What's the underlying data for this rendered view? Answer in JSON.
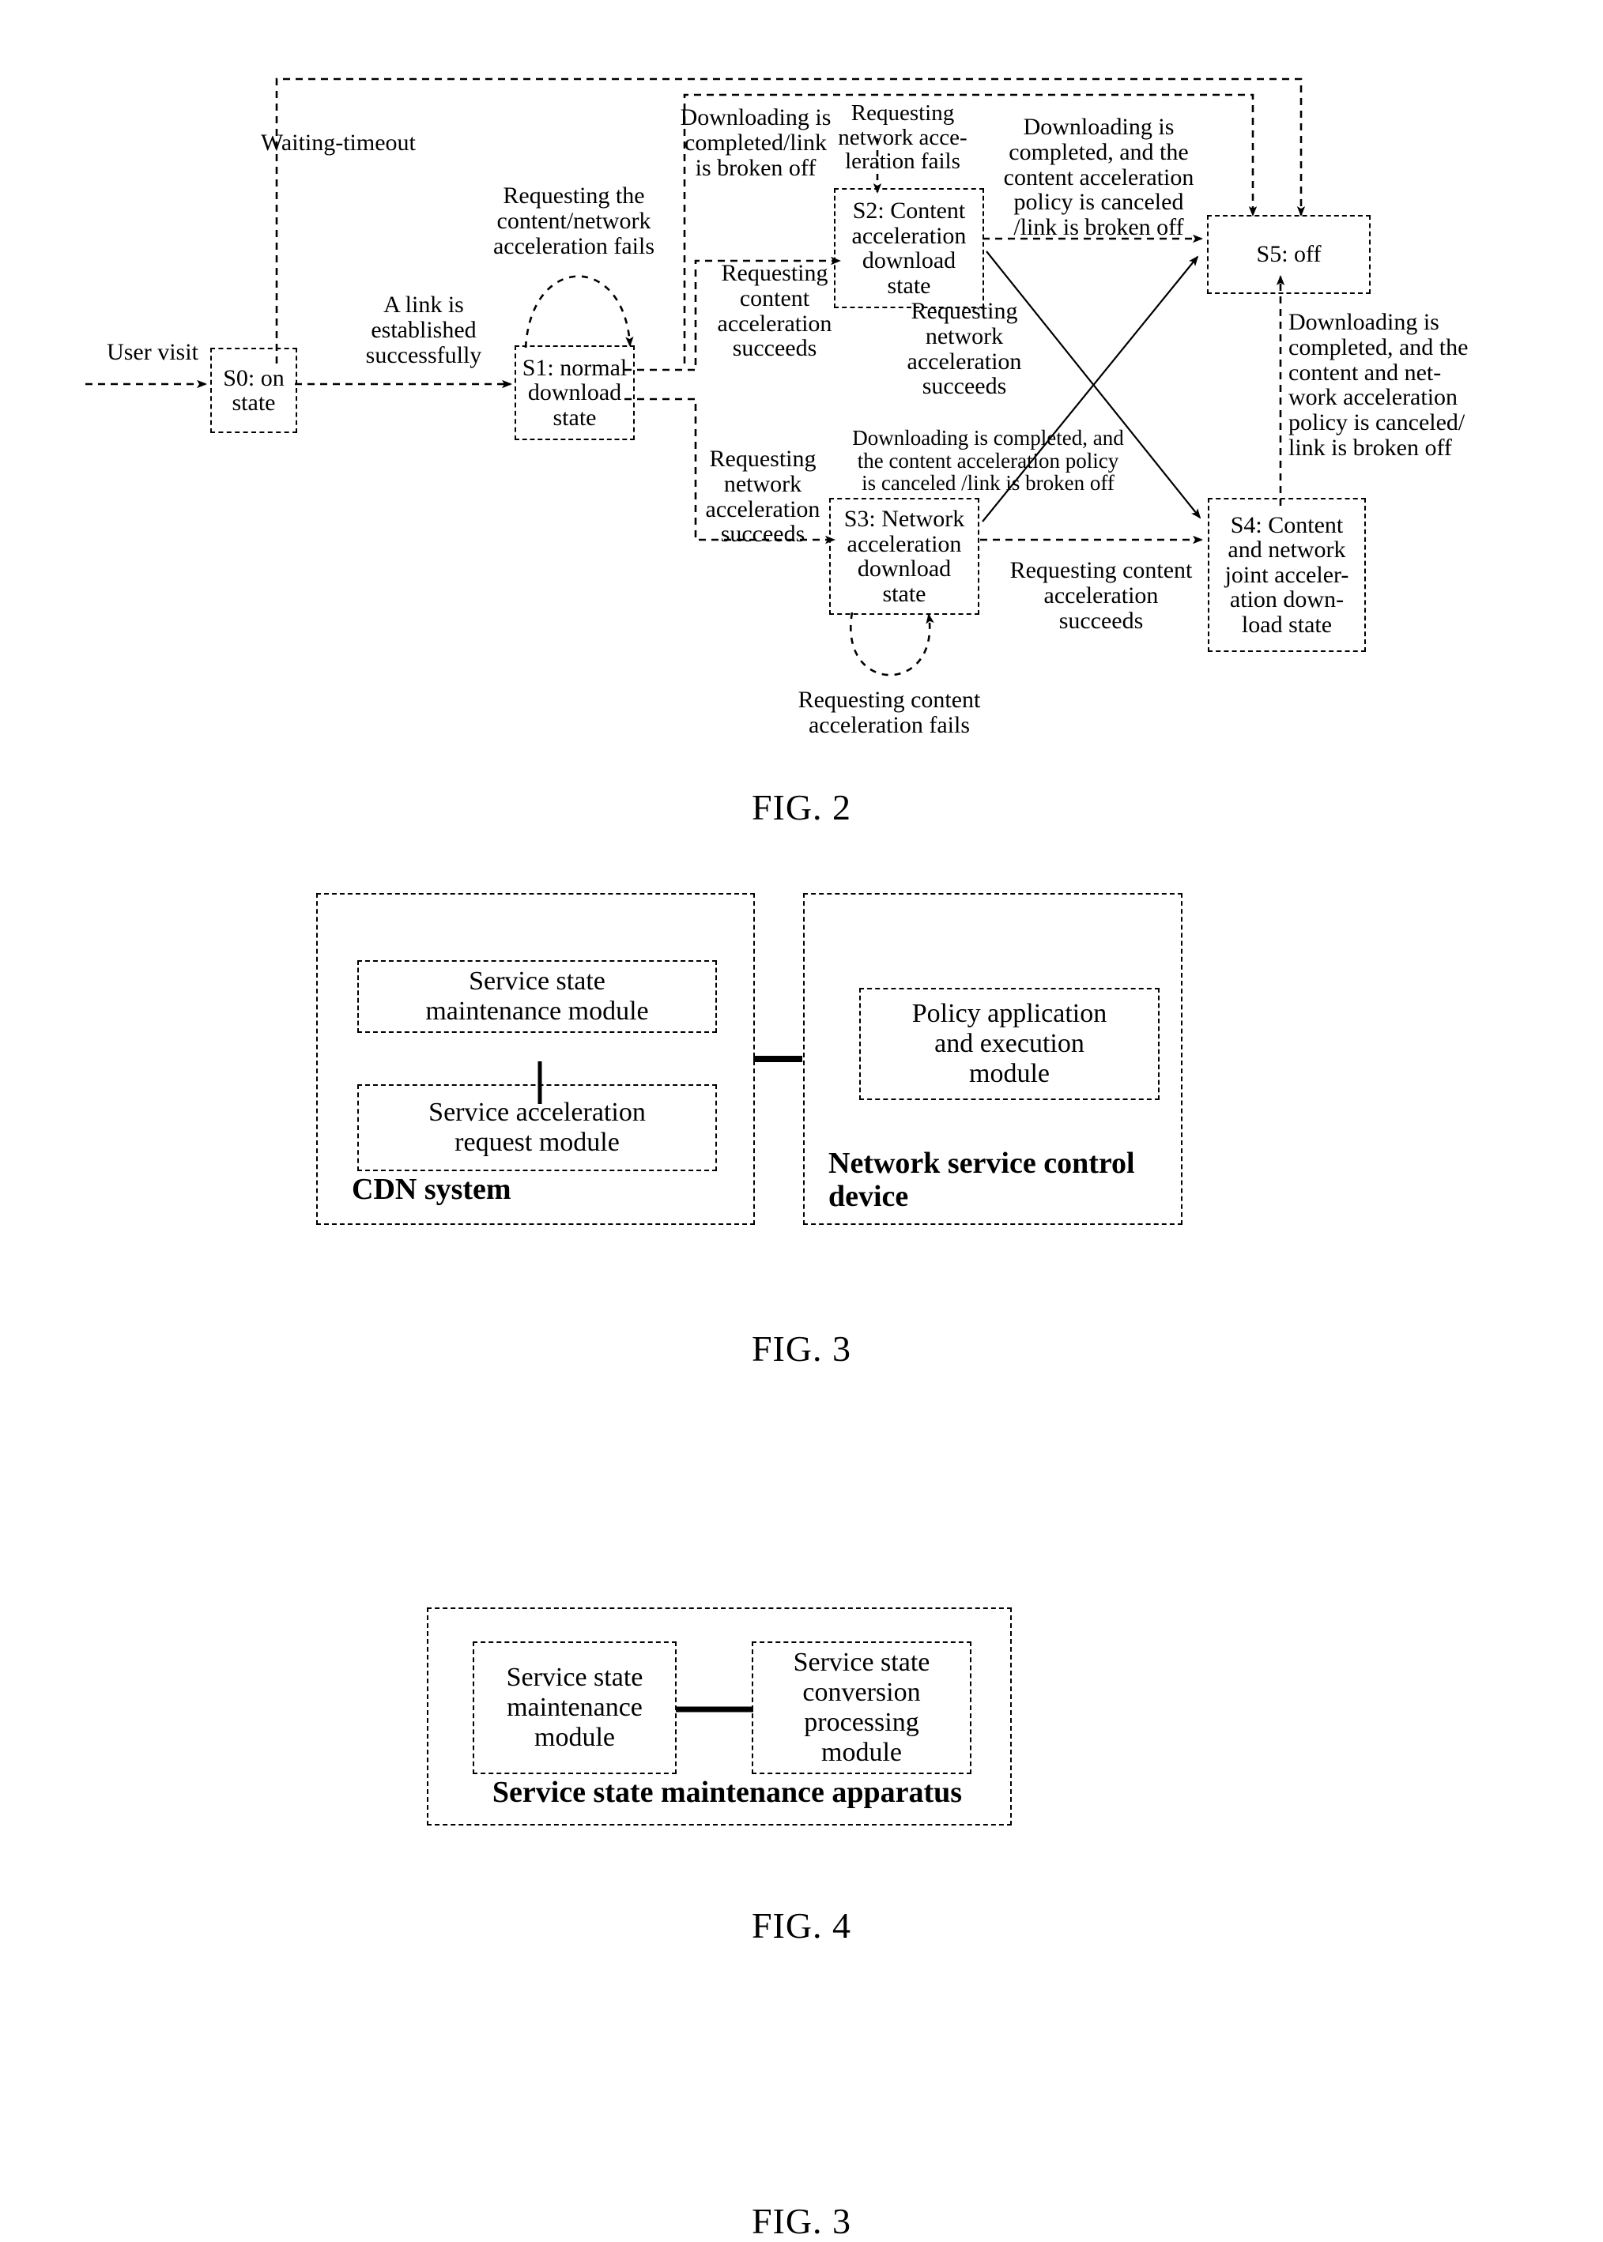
{
  "figures": [
    {
      "caption": "FIG. 2",
      "states": [
        {
          "id": "S0",
          "label": "S0: on\nstate"
        },
        {
          "id": "S1",
          "label": "S1: normal\ndownload\nstate"
        },
        {
          "id": "S2",
          "label": "S2: Content\nacceleration\ndownload\nstate"
        },
        {
          "id": "S3",
          "label": "S3: Network\nacceleration\ndownload\nstate"
        },
        {
          "id": "S4",
          "label": "S4: Content\nand network\njoint acceler-\nation down-\nload state"
        },
        {
          "id": "S5",
          "label": "S5: off"
        }
      ],
      "transitions": [
        {
          "id": "t-user-visit",
          "label": "User visit"
        },
        {
          "id": "t-waiting-timeout",
          "label": "Waiting-timeout"
        },
        {
          "id": "t-link-established",
          "label": "A link is\nestablished\nsuccessfully"
        },
        {
          "id": "t-req-cn-fails",
          "label": "Requesting the\ncontent/network\nacceleration fails"
        },
        {
          "id": "t-dl-complete-link",
          "label": "Downloading is\ncompleted/link\nis broken off"
        },
        {
          "id": "t-req-net-fails",
          "label": "Requesting\nnetwork acce-\nleration fails"
        },
        {
          "id": "t-req-content-succ",
          "label": "Requesting\ncontent\nacceleration\nsucceeds"
        },
        {
          "id": "t-req-net-succ",
          "label": "Requesting\nnetwork\nacceleration\nsucceeds"
        },
        {
          "id": "t-dl-cap-canceled",
          "label": "Downloading is\ncompleted, and the\ncontent acceleration\npolicy is canceled\n/link is broken off"
        },
        {
          "id": "t-req-net-succ-2",
          "label": "Requesting\nnetwork\nacceleration\nsucceeds"
        },
        {
          "id": "t-dl-cap-canceled-2",
          "label": "Downloading is completed, and\nthe content acceleration policy\nis canceled /link is broken off"
        },
        {
          "id": "t-req-content-succ-2",
          "label": "Requesting content\nacceleration\nsucceeds"
        },
        {
          "id": "t-dl-cn-canceled",
          "label": "Downloading is\ncompleted, and the\ncontent and net-\nwork acceleration\npolicy is canceled/\nlink is broken off"
        },
        {
          "id": "t-req-content-fails",
          "label": "Requesting content\nacceleration fails"
        }
      ]
    },
    {
      "caption": "FIG. 3",
      "containers": [
        {
          "id": "cdn",
          "title": "CDN system",
          "modules": [
            "Service state\nmaintenance module",
            "Service acceleration\nrequest module"
          ]
        },
        {
          "id": "nscd",
          "title": "Network service control\ndevice",
          "modules": [
            "Policy application\nand execution\nmodule"
          ]
        }
      ]
    },
    {
      "caption": "FIG. 4",
      "containers": [
        {
          "id": "apparatus",
          "title": "Service state maintenance apparatus",
          "modules": [
            "Service state\nmaintenance\nmodule",
            "Service state\nconversion\nprocessing\nmodule"
          ]
        }
      ]
    }
  ]
}
